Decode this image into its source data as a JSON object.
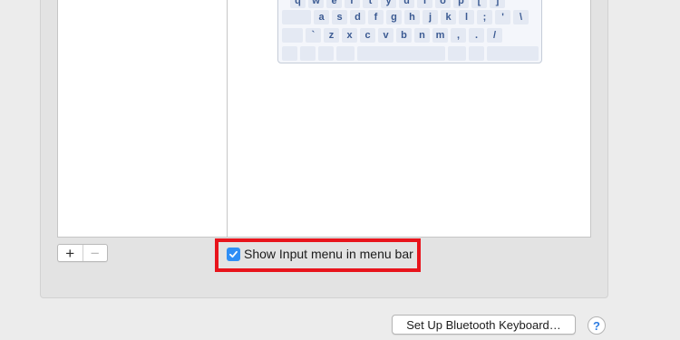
{
  "keyboard": {
    "row1": [
      "q",
      "w",
      "e",
      "r",
      "t",
      "y",
      "u",
      "i",
      "o",
      "p",
      "[",
      "]"
    ],
    "row2": [
      "a",
      "s",
      "d",
      "f",
      "g",
      "h",
      "j",
      "k",
      "l",
      ";",
      "'",
      "\\"
    ],
    "row3": [
      "`",
      "z",
      "x",
      "c",
      "v",
      "b",
      "n",
      "m",
      ",",
      ".",
      "/"
    ]
  },
  "controls": {
    "add_label": "+",
    "remove_label": "−",
    "show_input_menu_label": "Show Input menu in menu bar",
    "show_input_menu_checked": true,
    "bluetooth_button_label": "Set Up Bluetooth Keyboard…",
    "help_label": "?"
  },
  "colors": {
    "highlight": "#e8141c",
    "checkbox": "#2f8ef5",
    "key_text": "#3b5a92"
  }
}
